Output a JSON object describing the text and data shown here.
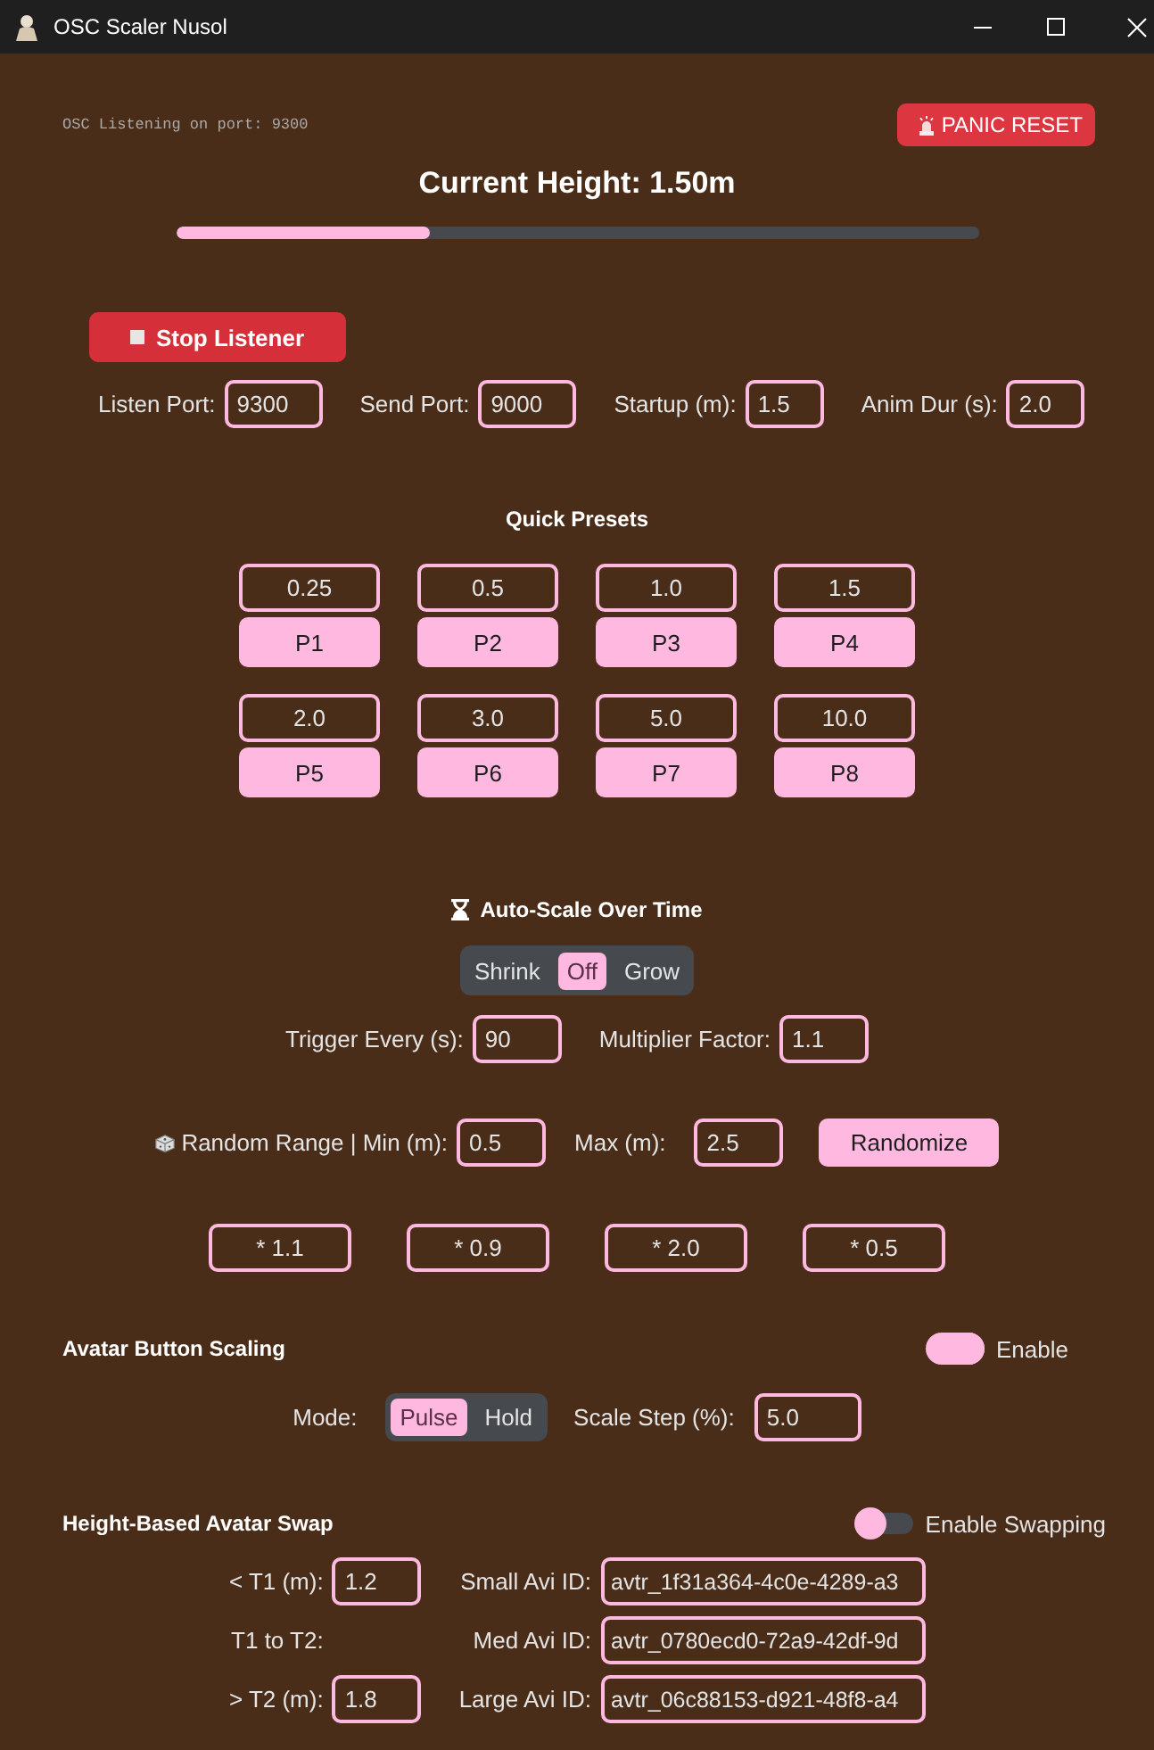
{
  "window": {
    "title": "OSC Scaler Nusol"
  },
  "status": {
    "text": "OSC Listening on port: 9300"
  },
  "panic_button": {
    "label": "PANIC RESET"
  },
  "height": {
    "label": "Current Height: 1.50m",
    "level": 0.316
  },
  "listener_button": {
    "label": "Stop Listener"
  },
  "settings": [
    {
      "label": "Listen Port:",
      "value": "9300"
    },
    {
      "label": "Send Port:",
      "value": "9000"
    },
    {
      "label": "Startup (m):",
      "value": "1.5"
    },
    {
      "label": "Anim Dur (s):",
      "value": "2.0"
    }
  ],
  "presets": {
    "title": "Quick Presets",
    "items": [
      {
        "value": "0.25",
        "label": "P1"
      },
      {
        "value": "0.5",
        "label": "P2"
      },
      {
        "value": "1.0",
        "label": "P3"
      },
      {
        "value": "1.5",
        "label": "P4"
      },
      {
        "value": "2.0",
        "label": "P5"
      },
      {
        "value": "3.0",
        "label": "P6"
      },
      {
        "value": "5.0",
        "label": "P7"
      },
      {
        "value": "10.0",
        "label": "P8"
      }
    ]
  },
  "auto_scale": {
    "title": "Auto-Scale Over Time",
    "modes": [
      {
        "label": "Shrink",
        "selected": false
      },
      {
        "label": "Off",
        "selected": true
      },
      {
        "label": "Grow",
        "selected": false
      }
    ],
    "fields": [
      {
        "label": "Trigger Every (s):",
        "value": "90"
      },
      {
        "label": "Multiplier Factor:",
        "value": "1.1"
      }
    ]
  },
  "random_range": {
    "fields": [
      {
        "label": "Random Range | Min (m):",
        "value": "0.5"
      },
      {
        "label": "Max (m):",
        "value": "2.5"
      }
    ],
    "button": "Randomize"
  },
  "multipliers": [
    "* 1.1",
    "* 0.9",
    "* 2.0",
    "* 0.5"
  ],
  "avatar_scaling": {
    "title": "Avatar Button Scaling",
    "toggle": {
      "label": "Enable",
      "on": true
    },
    "mode_label": "Mode:",
    "modes": [
      {
        "label": "Pulse",
        "selected": true
      },
      {
        "label": "Hold",
        "selected": false
      }
    ],
    "step": {
      "label": "Scale Step (%):",
      "value": "5.0"
    }
  },
  "avatar_swap": {
    "title": "Height-Based Avatar Swap",
    "toggle": {
      "label": "Enable Swapping",
      "on": false
    },
    "rows": [
      {
        "threshold_label": "< T1 (m):",
        "threshold_value": "1.2",
        "id_label": "Small Avi ID:",
        "id_value": "avtr_1f31a364-4c0e-4289-a3"
      },
      {
        "threshold_label": "T1 to T2:",
        "id_label": "Med Avi ID:",
        "id_value": "avtr_0780ecd0-72a9-42df-9d"
      },
      {
        "threshold_label": "> T2 (m):",
        "threshold_value": "1.8",
        "id_label": "Large Avi ID:",
        "id_value": "avtr_06c88153-d921-48f8-a4"
      }
    ]
  }
}
